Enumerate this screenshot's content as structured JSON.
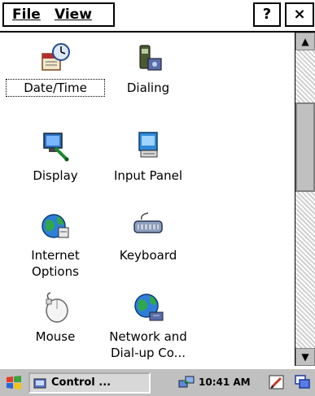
{
  "menubar": {
    "file_label": "File",
    "view_label": "View",
    "help_label": "?",
    "close_label": "×"
  },
  "items": [
    {
      "label": "Date/Time",
      "icon": "datetime-icon"
    },
    {
      "label": "Dialing",
      "icon": "dialing-icon"
    },
    {
      "label": "Display",
      "icon": "display-icon"
    },
    {
      "label": "Input Panel",
      "icon": "input-panel-icon"
    },
    {
      "label": "Internet Options",
      "icon": "internet-options-icon"
    },
    {
      "label": "Keyboard",
      "icon": "keyboard-icon"
    },
    {
      "label": "Mouse",
      "icon": "mouse-icon"
    },
    {
      "label": "Network and Dial-up Co...",
      "icon": "network-icon"
    }
  ],
  "scrollbar": {
    "up_glyph": "▲",
    "down_glyph": "▼"
  },
  "taskbar": {
    "task_label": "Control ...",
    "clock": "10:41 AM"
  }
}
